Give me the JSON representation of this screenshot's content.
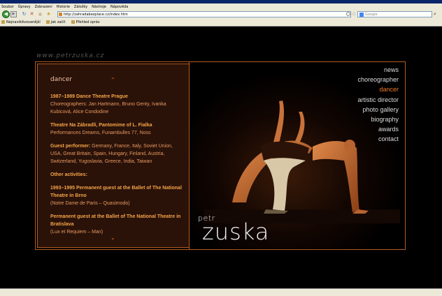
{
  "browser": {
    "menu": [
      "Soubor",
      "Úpravy",
      "Zobrazení",
      "Historie",
      "Záložky",
      "Nástroje",
      "Nápověda"
    ],
    "url": "http://zahradabezplace.cz/index.htm",
    "search_placeholder": "Google",
    "bookmarks": [
      "Nejnavštěvovanější",
      "Jak začít",
      "Přehled zpráv"
    ]
  },
  "page": {
    "logo_url": "www.petrzuska.cz",
    "section_title": "dancer",
    "nav": [
      {
        "label": "news",
        "active": false
      },
      {
        "label": "choreographer",
        "active": false
      },
      {
        "label": "dancer",
        "active": true
      },
      {
        "label": "artistic director",
        "active": false
      },
      {
        "label": "photo gallery",
        "active": false
      },
      {
        "label": "biography",
        "active": false
      },
      {
        "label": "awards",
        "active": false
      },
      {
        "label": "contact",
        "active": false
      }
    ],
    "brand_first": "petr",
    "brand_last": "zuska",
    "entries": [
      {
        "heading": "1987–1989 Dance Theatre Prague",
        "text": "Choreographers: Jan Hartmann, Bruno Genty, Ivanka Kubicová, Alice Condodine"
      },
      {
        "heading": "Theatre Na Zábradlí, Pantomime of L. Fialka",
        "text": "Performances Dreams, Funambulles 77, Noss"
      },
      {
        "heading": "Guest performer:",
        "text": " Germany, France, Italy, Soviet Union, USA, Great Britain, Spain, Hungary, Finland, Austria, Switzerland, Yugoslavia, Greece, India, Taiwan"
      },
      {
        "heading": "Other activities:",
        "text": ""
      },
      {
        "heading": "1993–1995 Permanent guest at the Ballet of The National Theatre in Brno",
        "text": "(Notre Dame de Paris – Quasimodo)"
      },
      {
        "heading": "Permanent guest at the Ballet of The National Theatre in Bratislava",
        "text": "(Lux et Requiem – Man)"
      }
    ]
  }
}
